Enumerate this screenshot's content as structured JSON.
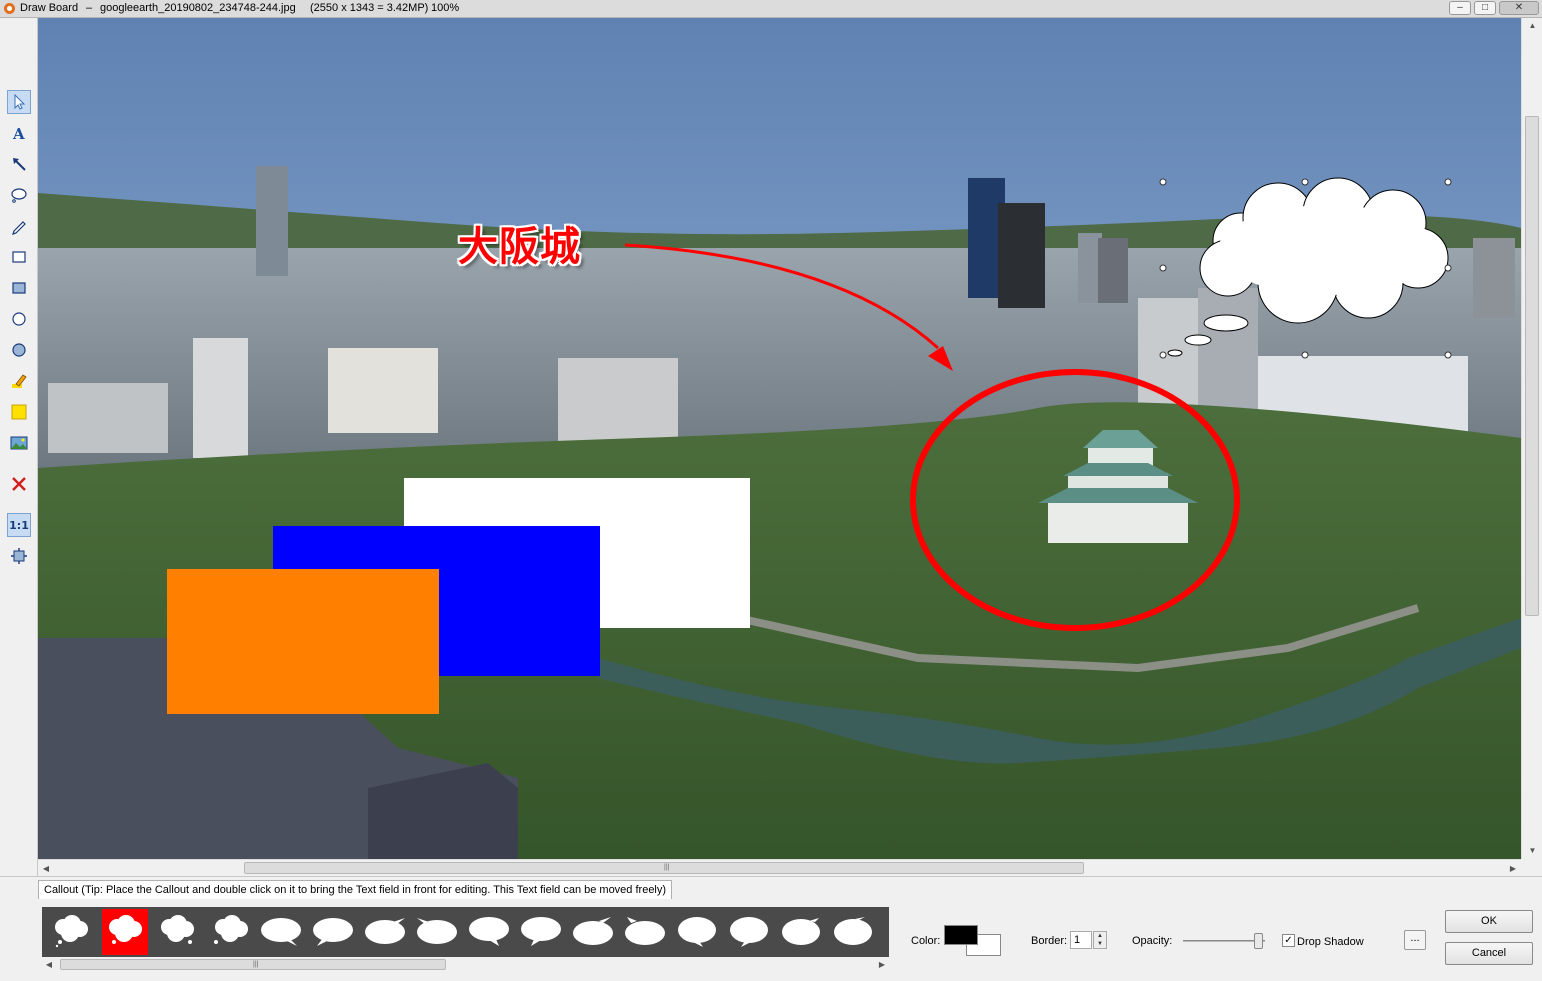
{
  "window": {
    "app_name": "Draw Board",
    "separator": "–",
    "file_name": "googleearth_20190802_234748-244.jpg",
    "image_info": "(2550 x 1343 = 3.42MP)",
    "zoom": "100%",
    "minimize_symbol": "–",
    "maximize_symbol": "□",
    "close_symbol": "✕"
  },
  "toolbar": {
    "tools": [
      {
        "name": "select-tool",
        "icon": "pointer-icon",
        "active": true
      },
      {
        "name": "text-tool",
        "icon": "text-a-icon"
      },
      {
        "name": "arrow-tool",
        "icon": "arrow-icon"
      },
      {
        "name": "callout-tool",
        "icon": "callout-bubble-icon"
      },
      {
        "name": "pen-tool",
        "icon": "pencil-icon"
      },
      {
        "name": "rectangle-tool",
        "icon": "rectangle-outline-icon"
      },
      {
        "name": "filled-rectangle-tool",
        "icon": "rectangle-filled-icon"
      },
      {
        "name": "ellipse-tool",
        "icon": "ellipse-outline-icon"
      },
      {
        "name": "filled-ellipse-tool",
        "icon": "ellipse-filled-icon"
      },
      {
        "name": "highlighter-tool",
        "icon": "highlighter-icon"
      },
      {
        "name": "highlight-rect-tool",
        "icon": "yellow-square-icon"
      },
      {
        "name": "image-tool",
        "icon": "picture-icon"
      },
      {
        "name": "delete-tool",
        "icon": "red-x-icon"
      },
      {
        "name": "actual-size-tool",
        "label": "1:1"
      },
      {
        "name": "fit-tool",
        "icon": "fit-window-icon"
      }
    ]
  },
  "canvas": {
    "annotation_text": "大阪城",
    "annotation_color": "#ff0000",
    "shapes": {
      "white": "#ffffff",
      "blue": "#0000ff",
      "orange": "#ff8000"
    }
  },
  "scrollbars": {
    "grip": "|||",
    "up": "▲",
    "down": "▼",
    "left": "◀",
    "right": "▶"
  },
  "panel": {
    "tab_label": "Callout (Tip: Place the Callout and double click on it to bring the Text field in front for editing. This Text field can be moved freely)",
    "callout_count": 16,
    "selected_index": 1,
    "color_label": "Color:",
    "border_label": "Border:",
    "border_value": "1",
    "opacity_label": "Opacity:",
    "opacity_value": 1.0,
    "drop_shadow_label": "Drop Shadow",
    "drop_shadow_checked": true,
    "more_label": "...",
    "ok_label": "OK",
    "cancel_label": "Cancel",
    "fg_color": "#000000",
    "bg_color": "#ffffff"
  }
}
